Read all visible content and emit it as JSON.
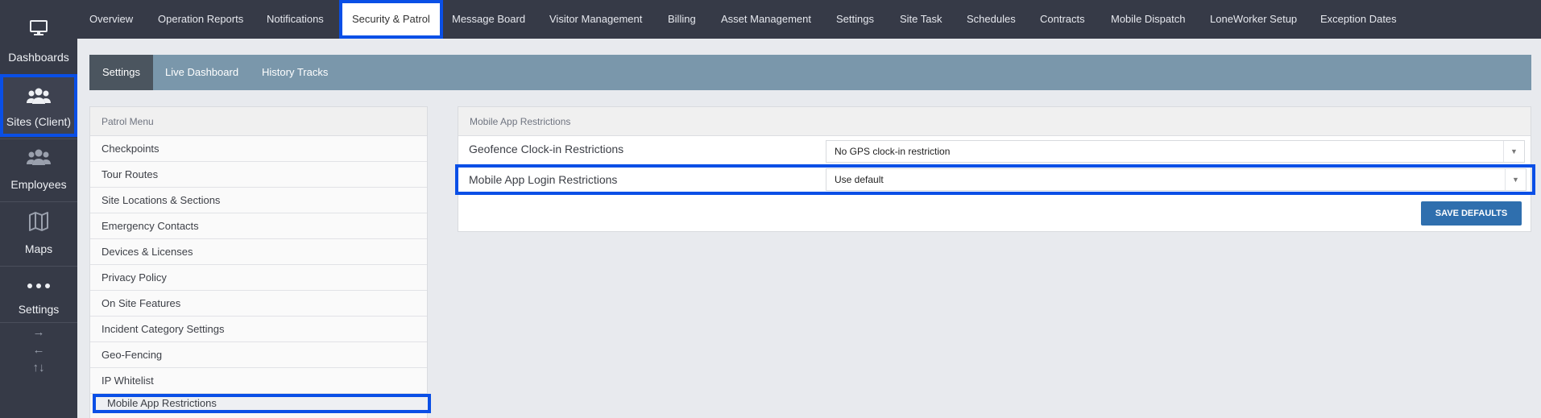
{
  "sidebar": {
    "items": [
      {
        "label": "Dashboards",
        "icon": "monitor-icon"
      },
      {
        "label": "Sites (Client)",
        "icon": "users-group-icon"
      },
      {
        "label": "Employees",
        "icon": "users-group-icon"
      },
      {
        "label": "Maps",
        "icon": "map-icon"
      },
      {
        "label": "Settings",
        "icon": "ellipsis-icon"
      }
    ],
    "arrows": [
      "→",
      "←",
      "↑↓"
    ]
  },
  "topnav": {
    "tabs": [
      "Overview",
      "Operation Reports",
      "Notifications",
      "Security & Patrol",
      "Message Board",
      "Visitor Management",
      "Billing",
      "Asset Management",
      "Settings",
      "Site Task",
      "Schedules",
      "Contracts",
      "Mobile Dispatch",
      "LoneWorker Setup",
      "Exception Dates"
    ],
    "active": "Security & Patrol"
  },
  "subtabs": [
    "Settings",
    "Live Dashboard",
    "History Tracks"
  ],
  "patrol_menu": {
    "title": "Patrol Menu",
    "items": [
      "Checkpoints",
      "Tour Routes",
      "Site Locations & Sections",
      "Emergency Contacts",
      "Devices & Licenses",
      "Privacy Policy",
      "On Site Features",
      "Incident Category Settings",
      "Geo-Fencing",
      "IP Whitelist",
      "Mobile App Restrictions"
    ],
    "active": "Mobile App Restrictions"
  },
  "restrictions": {
    "title": "Mobile App Restrictions",
    "rows": [
      {
        "label": "Geofence Clock-in Restrictions",
        "value": "No GPS clock-in restriction"
      },
      {
        "label": "Mobile App Login Restrictions",
        "value": "Use default"
      }
    ],
    "save_label": "SAVE DEFAULTS"
  },
  "colors": {
    "sidebar_bg": "#363a47",
    "subbar_bg": "#7a97ab",
    "highlight": "#0a4fe6",
    "button": "#2f6fae"
  }
}
